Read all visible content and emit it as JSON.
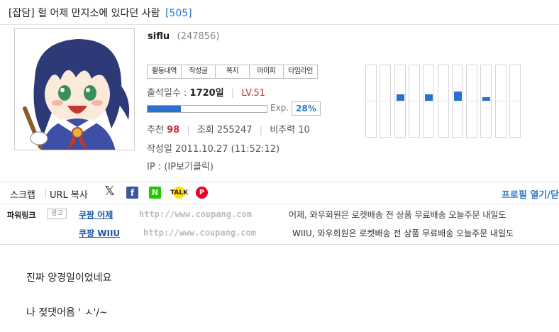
{
  "post": {
    "category": "[잡담]",
    "title": "헐 어제 만지소에 있다던 사람",
    "comment_count": "[505]"
  },
  "author": {
    "nickname": "siflu",
    "id": "(247856)",
    "buttons": [
      "활동내역",
      "작성글",
      "쪽지",
      "마이피",
      "타임라인"
    ],
    "attendance_label": "출석일수 :",
    "attendance_value": "1720일",
    "level": "LV.51",
    "exp_label": "Exp.",
    "exp_percent": "28%",
    "exp_fraction": 0.28,
    "recommend_label": "추천",
    "recommend_value": "98",
    "views": "조회 255247",
    "downvotes": "비추력 10",
    "created": "작성일 2011.10.27 (11:52:12)",
    "ip": "IP : (IP보기클릭)"
  },
  "activity_graph": {
    "levels": [
      0,
      0,
      1,
      0,
      1,
      0,
      1.4,
      0,
      0.6,
      0,
      0
    ]
  },
  "share": {
    "scrap": "스크랩",
    "url_copy": "URL 복사",
    "icons": [
      "x-icon",
      "facebook-icon",
      "naver-icon",
      "kakaotalk-icon",
      "pinterest-icon"
    ],
    "profile_toggle": "프로필 열기/닫"
  },
  "power_link": {
    "label": "파워링크",
    "badge": "광고",
    "ads": [
      {
        "title": "쿠팡 어제",
        "url": "http://www.coupang.com",
        "desc": "어제, 와우회원은 로켓배송 전 상품 무료배송 오늘주문 내일도"
      },
      {
        "title": "쿠팡 WIIU",
        "url": "http://www.coupang.com",
        "desc": "WIIU, 와우회원은 로켓배송 전 상품 무료배송 오늘주문 내일도"
      }
    ]
  },
  "body": {
    "line1": "진짜 양경일이었네요",
    "line2": "나 젖댓어욤 '  ㅅ'/~"
  },
  "colors": {
    "accent": "#2f7ac9",
    "level_red": "#c8323a",
    "bar_blue": "#2b6fd1"
  }
}
